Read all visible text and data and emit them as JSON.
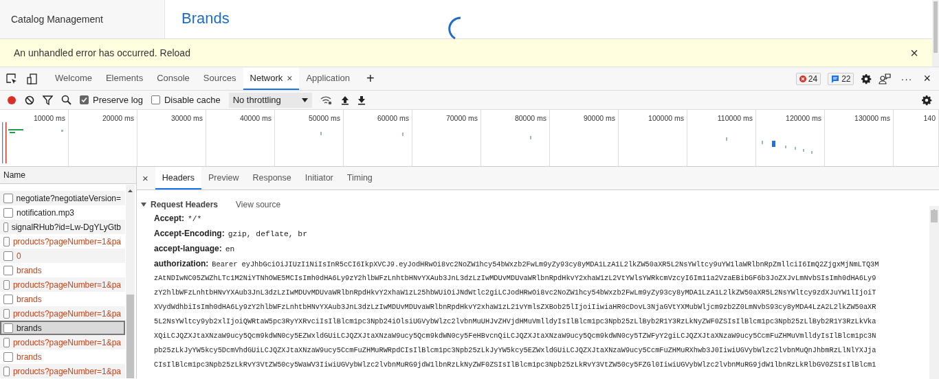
{
  "app": {
    "sidebar_title": "Catalog Management",
    "page_title": "Brands",
    "loading": true
  },
  "error_bar": {
    "message": "An unhandled error has occurred.",
    "link": "Reload",
    "close": "×"
  },
  "devtools": {
    "tabs": [
      {
        "label": "Welcome",
        "selected": false
      },
      {
        "label": "Elements",
        "selected": false
      },
      {
        "label": "Console",
        "selected": false
      },
      {
        "label": "Sources",
        "selected": false
      },
      {
        "label": "Network",
        "selected": true,
        "close": "×"
      },
      {
        "label": "Application",
        "selected": false
      }
    ],
    "add_tab": "+",
    "error_count": "24",
    "message_count": "22",
    "more": "···",
    "close": "×",
    "toolbar": {
      "recording": true,
      "preserve_log": {
        "label": "Preserve log",
        "checked": true
      },
      "disable_cache": {
        "label": "Disable cache",
        "checked": false
      },
      "throttling": "No throttling"
    },
    "overview": {
      "ticks": [
        "10000 ms",
        "20000 ms",
        "30000 ms",
        "40000 ms",
        "50000 ms",
        "60000 ms",
        "70000 ms",
        "80000 ms",
        "90000 ms",
        "100000 ms",
        "110000 ms",
        "120000 ms",
        "130000 ms",
        "140"
      ]
    },
    "requests": {
      "column": "Name",
      "rows": [
        {
          "name": "negotiate?negotiateVersion=",
          "error": false,
          "selected": false
        },
        {
          "name": "notification.mp3",
          "error": false,
          "selected": false
        },
        {
          "name": "signalRHub?id=Lw-DgYLyGtb",
          "error": false,
          "selected": false
        },
        {
          "name": "products?pageNumber=1&pa",
          "error": true,
          "selected": false
        },
        {
          "name": "0",
          "error": true,
          "selected": false
        },
        {
          "name": "brands",
          "error": true,
          "selected": false
        },
        {
          "name": "products?pageNumber=1&pa",
          "error": true,
          "selected": false
        },
        {
          "name": "brands",
          "error": true,
          "selected": false
        },
        {
          "name": "products?pageNumber=1&pa",
          "error": true,
          "selected": false
        },
        {
          "name": "brands",
          "error": false,
          "selected": true
        },
        {
          "name": "products?pageNumber=1&pa",
          "error": true,
          "selected": false
        },
        {
          "name": "brands",
          "error": true,
          "selected": false
        },
        {
          "name": "products?pageNumber=1&pa",
          "error": true,
          "selected": false
        }
      ]
    },
    "detail": {
      "close": "×",
      "tabs": [
        {
          "label": "Headers",
          "selected": true
        },
        {
          "label": "Preview",
          "selected": false
        },
        {
          "label": "Response",
          "selected": false
        },
        {
          "label": "Initiator",
          "selected": false
        },
        {
          "label": "Timing",
          "selected": false
        }
      ],
      "section": {
        "title": "Request Headers",
        "expanded": true,
        "view_source": "View source"
      },
      "headers": [
        {
          "name": "Accept:",
          "value": "*/*"
        },
        {
          "name": "Accept-Encoding:",
          "value": "gzip, deflate, br"
        },
        {
          "name": "accept-language:",
          "value": "en"
        }
      ],
      "authorization": {
        "name": "authorization:",
        "lines": [
          "Bearer eyJhbGciOiJIUzI1NiIsInR5cCI6IkpXVCJ9.eyJodHRwOi8vc2NoZW1hcy54bWxzb2FwLm9yZy93cy8yMDA1LzA1L2lkZW50aXR5L2NsYWltcy9uYW1laWRlbnRpZmllciI6ImQ2ZjgxMjNmLTQ3M",
          "zAtNDIwNC05ZWZhLTc1M2NiYTNhOWE5MCIsImh0dHA6Ly9zY2hlbWFzLnhtbHNvYXAub3JnL3dzLzIwMDUvMDUvaWRlbnRpdHkvY2xhaW1zL2VtYWlsYWRkcmVzcyI6Im11a2VzaEBibGF6b3JoZXJvLmNvbSIsImh0dHA6Ly9",
          "zY2hlbWFzLnhtbHNvYXAub3JnL3dzLzIwMDUvMDUvaWRlbnRpdHkvY2xhaW1zL25hbWUiOiJNdWtlc2giLCJodHRwOi8vc2NoZW1hcy54bWxzb2FwLm9yZy93cy8yMDA1LzA1L2lkZW50aXR5L2NsYWltcy9zdXJuYW1lIjoiT",
          "XVydWdhbiIsImh0dHA6Ly9zY2hlbWFzLnhtbHNvYXAub3JnL3dzLzIwMDUvMDUvaWRlbnRpdHkvY2xhaW1zL21vYmlsZXBob25lIjoiIiwiaHR0cDovL3NjaGVtYXMubWljcm9zb2Z0LmNvbS93cy8yMDA4LzA2L2lkZW50aXR",
          "5L2NsYWltcy9yb2xlIjoiQWRtaW5pc3RyYXRvciIsIlBlcm1pc3Npb24iOlsiUGVybWlzc2lvbnMuUHJvZHVjdHMuVmlldyIsIlBlcm1pc3Npb25zLlByb2R1Y3RzLkNyZWF0ZSIsIlBlcm1pc3Npb25zLlByb2R1Y3RzLkVka",
          "XQiLCJQZXJtaXNzaW9ucy5Qcm9kdWN0cy5EZWxldGUiLCJQZXJtaXNzaW9ucy5Qcm9kdWN0cy5FeHBvcnQiLCJQZXJtaXNzaW9ucy5Qcm9kdWN0cy5TZWFyY2giLCJQZXJtaXNzaW9ucy5CcmFuZHMuVmlldyIsIlBlcm1pc3N",
          "pb25zLkJyYW5kcy5DcmVhdGUiLCJQZXJtaXNzaW9ucy5CcmFuZHMuRWRpdCIsIlBlcm1pc3Npb25zLkJyYW5kcy5EZWxldGUiLCJQZXJtaXNzaW9ucy5CcmFuZHMuRXhwb3J0IiwiUGVybWlzc2lvbnMuQnJhbmRzLlNlYXJja",
          "CIsIlBlcm1pc3Npb25zLkRvY3VtZW50cy5WaWV3IiwiUGVybWlzc2lvbnMuRG9jdW1lbnRzLkNyZWF0ZSIsIlBlcm1pc3Npb25zLkRvY3VtZW50cy5FZGl0IiwiUGVybWlzc2lvbnMuRG9jdW1lbnRzLkRlbGV0ZSIsIlBlcm1"
        ]
      }
    }
  }
}
